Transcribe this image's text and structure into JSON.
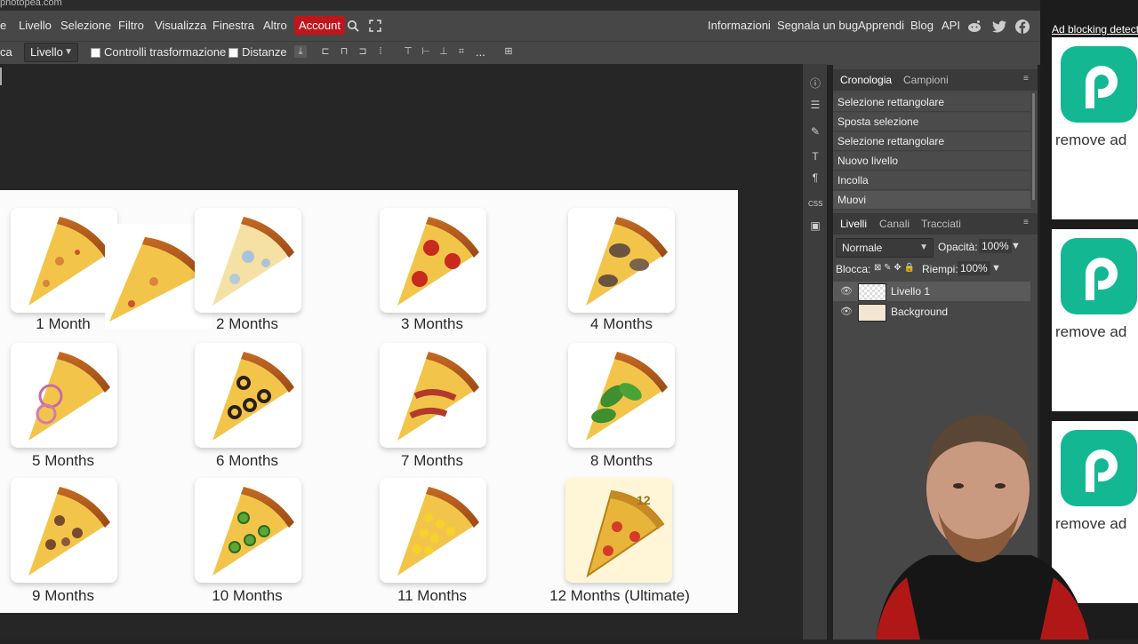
{
  "browser": {
    "url": "photopea.com"
  },
  "menubar": {
    "items": [
      "e",
      "Livello",
      "Selezione",
      "Filtro",
      "Visualizza",
      "Finestra",
      "Altro"
    ],
    "account": "Account",
    "right_links": [
      "Informazioni",
      "Segnala un bug",
      "Apprendi",
      "Blog",
      "API"
    ]
  },
  "optbar": {
    "tool_fragment": "ca",
    "layer_select": "Livello",
    "transform_controls": "Controlli trasformazione",
    "distances": "Distanze",
    "more": "..."
  },
  "history_panel": {
    "tabs": [
      "Cronologia",
      "Campioni"
    ],
    "items": [
      "Selezione rettangolare",
      "Sposta selezione",
      "Selezione rettangolare",
      "Nuovo livello",
      "Incolla",
      "Muovi"
    ]
  },
  "layers_panel": {
    "tabs": [
      "Livelli",
      "Canali",
      "Tracciati"
    ],
    "blend_mode": "Normale",
    "opacity_label": "Opacità:",
    "opacity_value": "100%",
    "lock_label": "Blocca:",
    "fill_label": "Riempi:",
    "fill_value": "100%",
    "layers": [
      "Livello 1",
      "Background"
    ]
  },
  "canvas": {
    "captions": [
      "1 Month",
      "2 Months",
      "3 Months",
      "4 Months",
      "5 Months",
      "6 Months",
      "7 Months",
      "8 Months",
      "9 Months",
      "10 Months",
      "11 Months",
      "12 Months (Ultimate)"
    ],
    "badge_number": "12"
  },
  "ad": {
    "title": "Ad blocking detecte",
    "card_text": "remove ad"
  },
  "colors": {
    "accent_red": "#c0151b",
    "ad_green": "#13b893"
  }
}
